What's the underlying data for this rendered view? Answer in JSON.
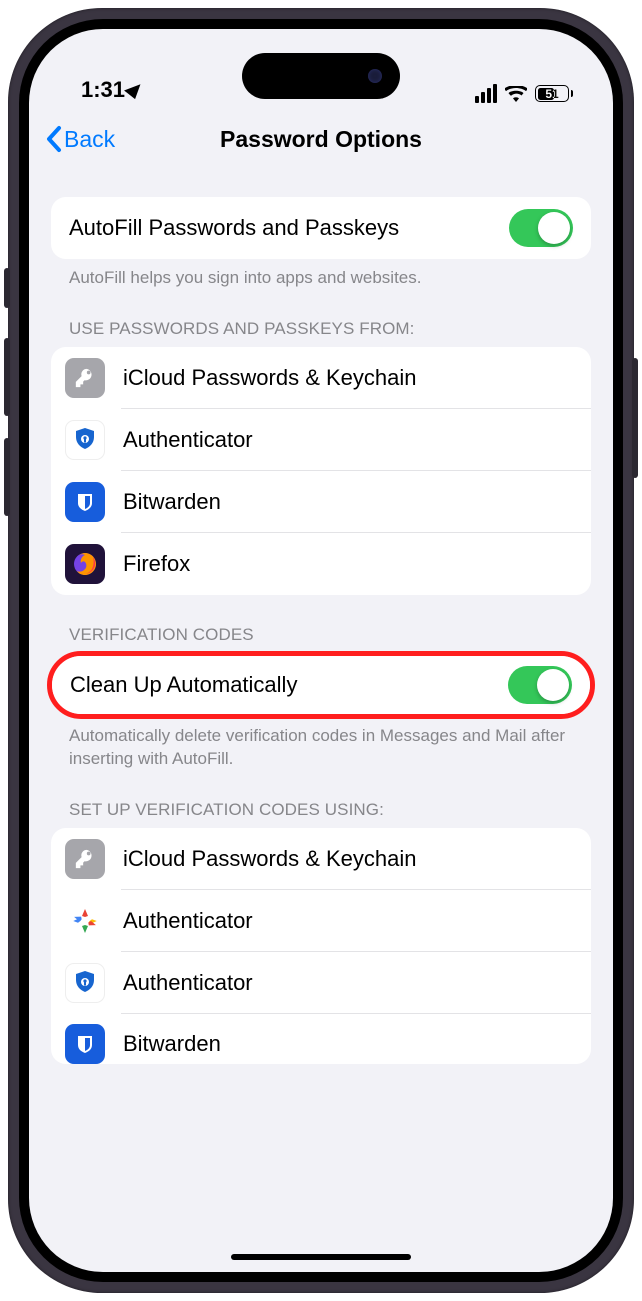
{
  "status": {
    "time": "1:31",
    "battery": "51"
  },
  "nav": {
    "back": "Back",
    "title": "Password Options"
  },
  "sections": {
    "autofill": {
      "label": "AutoFill Passwords and Passkeys",
      "footer": "AutoFill helps you sign into apps and websites."
    },
    "providers": {
      "header": "USE PASSWORDS AND PASSKEYS FROM:",
      "items": [
        "iCloud Passwords & Keychain",
        "Authenticator",
        "Bitwarden",
        "Firefox"
      ]
    },
    "verification": {
      "header": "VERIFICATION CODES",
      "cleanup_label": "Clean Up Automatically",
      "footer": "Automatically delete verification codes in Messages and Mail after inserting with AutoFill."
    },
    "setup": {
      "header": "SET UP VERIFICATION CODES USING:",
      "items": [
        "iCloud Passwords & Keychain",
        "Authenticator",
        "Authenticator",
        "Bitwarden"
      ]
    }
  }
}
